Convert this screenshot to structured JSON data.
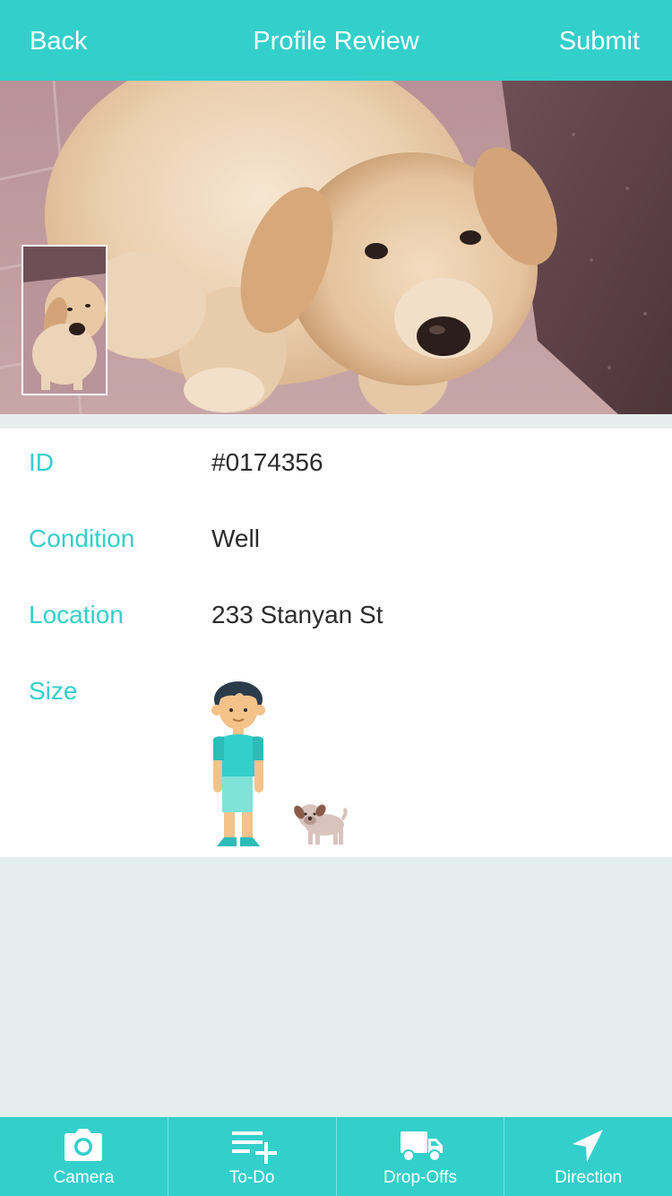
{
  "nav": {
    "back_label": "Back",
    "title": "Profile Review",
    "submit_label": "Submit"
  },
  "profile": {
    "rows": [
      {
        "label": "ID",
        "value": "#0174356"
      },
      {
        "label": "Condition",
        "value": "Well"
      },
      {
        "label": "Location",
        "value": "233 Stanyan St"
      },
      {
        "label": "Size",
        "value": ""
      }
    ]
  },
  "tabs": [
    {
      "label": "Camera",
      "icon": "camera-icon"
    },
    {
      "label": "To-Do",
      "icon": "todo-add-icon"
    },
    {
      "label": "Drop-Offs",
      "icon": "truck-icon"
    },
    {
      "label": "Direction",
      "icon": "navigation-arrow-icon"
    }
  ],
  "colors": {
    "accent": "#33cfcb",
    "background": "#e6eeed",
    "text": "#2b2b2b"
  }
}
